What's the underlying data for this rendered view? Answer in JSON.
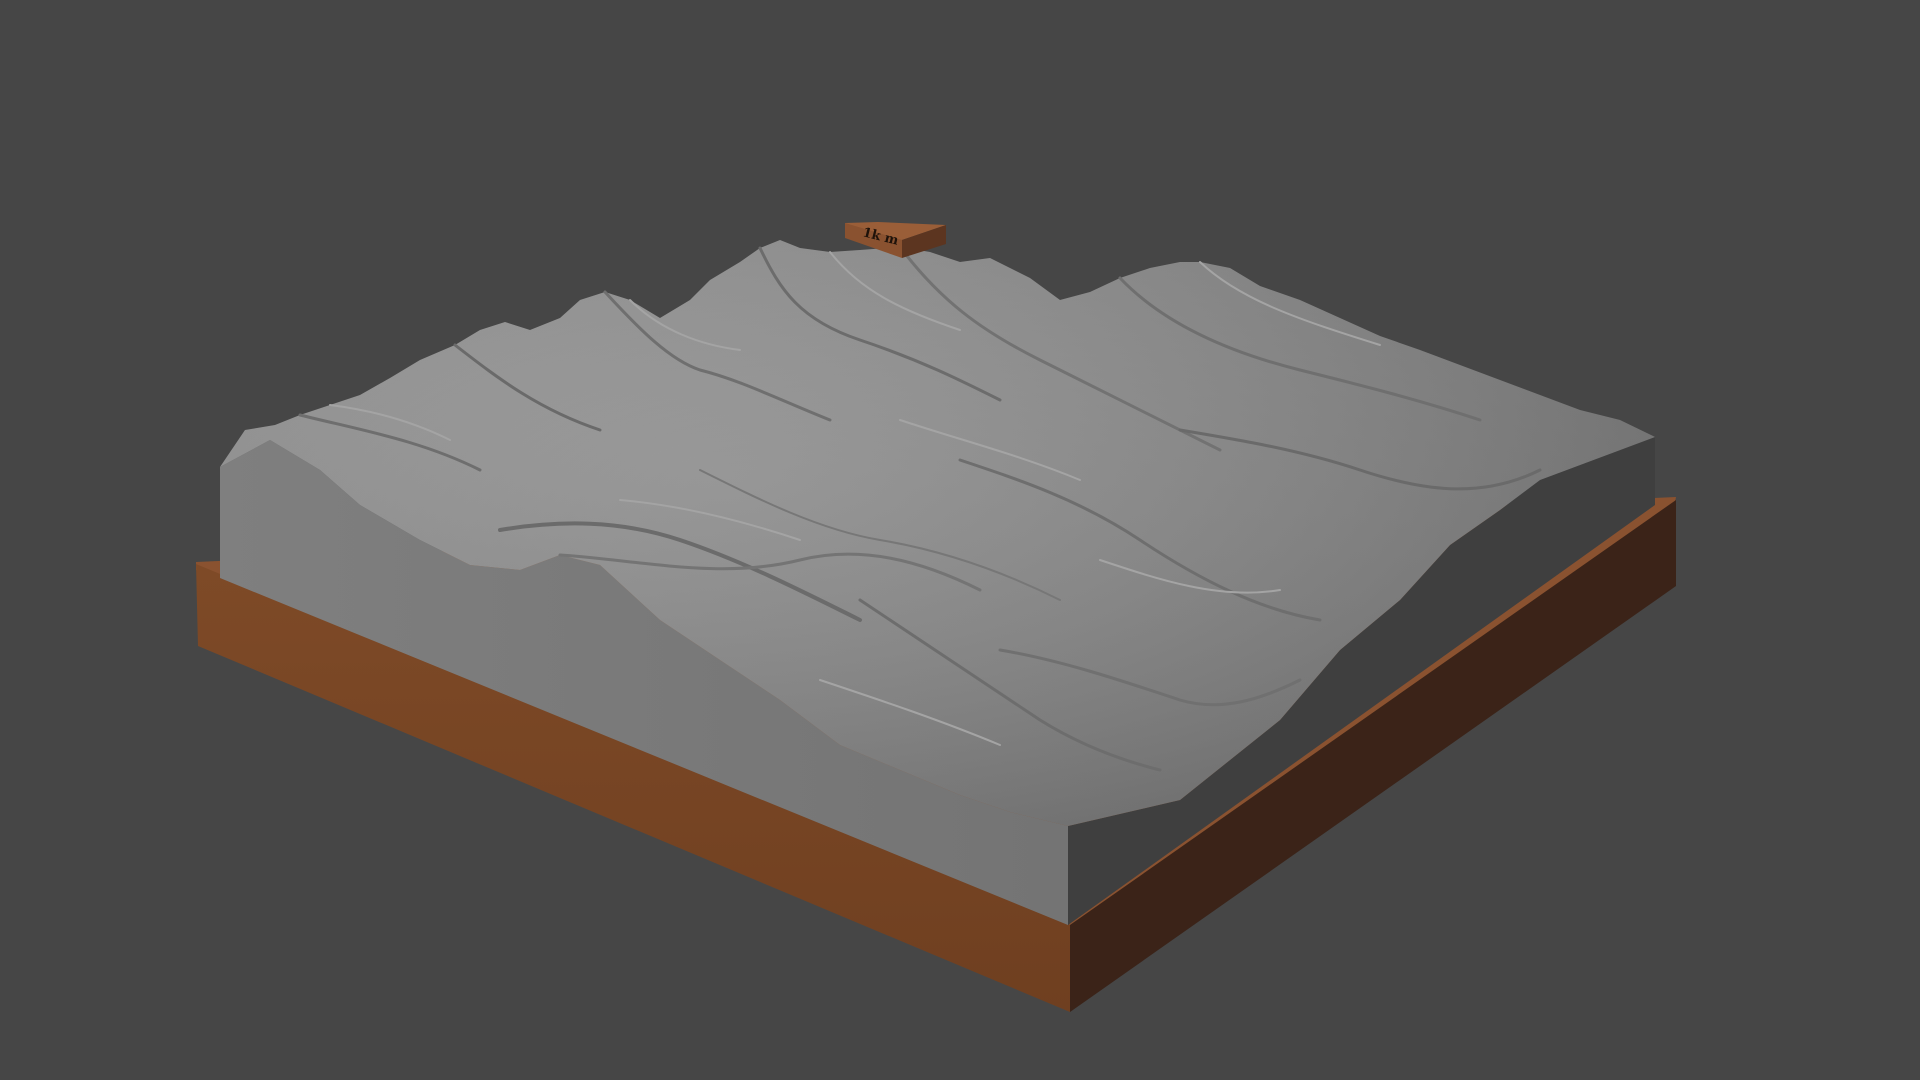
{
  "scene": {
    "description_free": true,
    "object": "terrain-relief-model",
    "background_color": "#464646",
    "colors": {
      "terrain_top": "#8c8c8c",
      "terrain_side_front": "#7a7a7a",
      "terrain_side_right": "#3f3f3f",
      "base_front": "#7a4725",
      "base_top": "#8a5230",
      "base_right": "#3a2217",
      "label_block": "#8a5230"
    }
  },
  "label_block": {
    "text": "1k m"
  }
}
